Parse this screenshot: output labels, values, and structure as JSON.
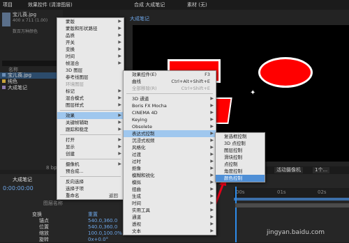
{
  "top_panel": {
    "label": "项目",
    "effects_tab": "效果控件 (清漆图层)",
    "comp_tab": "合成 大成笔记",
    "footage_tab": "素材 (无)"
  },
  "project_item": {
    "name": "宝儿莨.jpg",
    "size": "400 x 711 (1.00)",
    "mode": "数百万种颜色"
  },
  "project_list": [
    {
      "name": "宝儿莨.jpg",
      "color": "#6b8fb8"
    },
    {
      "name": "纯色",
      "color": "#c9a43a"
    },
    {
      "name": "大成笔记",
      "color": "#8c7bb0"
    }
  ],
  "project_header": {
    "name_col": "名称"
  },
  "comp_tab_label": "大成笔记",
  "bpc": "8 bpc",
  "camera": "活动摄像机",
  "views": "1个...",
  "timeline": {
    "tab": "大成笔记",
    "timecode": "0:00:00:00",
    "source_name_header": "图层名称",
    "ruler": [
      "00s",
      "01s",
      "02s"
    ],
    "rows": [
      {
        "label": "变换",
        "value": "重置"
      },
      {
        "label": "锚点",
        "value": "540.0,360.0"
      },
      {
        "label": "位置",
        "value": "540.0,360.0"
      },
      {
        "label": "缩放",
        "value": "100.0,100.0%"
      },
      {
        "label": "旋转",
        "value": "0x+0.0°"
      }
    ]
  },
  "menu_main": {
    "items": [
      {
        "label": "蒙版",
        "arrow": true
      },
      {
        "label": "蒙版和形状路径",
        "arrow": true
      },
      {
        "label": "品质",
        "arrow": true
      },
      {
        "label": "开关",
        "arrow": true
      },
      {
        "label": "变换",
        "arrow": true
      },
      {
        "label": "时间",
        "arrow": true
      },
      {
        "label": "帧混合",
        "arrow": true
      },
      {
        "label": "3D 图层"
      },
      {
        "label": "参考线图层"
      },
      {
        "label": "环境图层",
        "disabled": true
      },
      {
        "label": "标记",
        "arrow": true
      },
      {
        "label": "混合模式",
        "arrow": true
      },
      {
        "label": "图层样式",
        "arrow": true
      },
      {
        "sep": true
      },
      {
        "label": "效果",
        "arrow": true,
        "highlight": true
      },
      {
        "label": "关键帧辅助",
        "arrow": true
      },
      {
        "label": "跟踪和稳定",
        "arrow": true
      },
      {
        "sep": true
      },
      {
        "label": "打开",
        "arrow": true
      },
      {
        "label": "显示",
        "arrow": true
      },
      {
        "label": "创建",
        "arrow": true
      },
      {
        "sep": true
      },
      {
        "label": "摄像机",
        "arrow": true
      },
      {
        "label": "预合成..."
      },
      {
        "sep": true
      },
      {
        "label": "反向选择"
      },
      {
        "label": "选择子项"
      },
      {
        "label": "重命名",
        "shortcut": "返回"
      }
    ]
  },
  "menu_effects": {
    "items": [
      {
        "label": "效果控件(E)",
        "shortcut": "F3"
      },
      {
        "label": "曲线",
        "shortcut": "Ctrl+Alt+Shift+E"
      },
      {
        "label": "全部移除(R)",
        "shortcut": "Ctrl+Shift+E",
        "disabled": true
      },
      {
        "sep": true
      },
      {
        "label": "3D 通道",
        "arrow": true
      },
      {
        "label": "Boris FX Mocha",
        "arrow": true
      },
      {
        "label": "CINEMA 4D",
        "arrow": true
      },
      {
        "label": "Keying",
        "arrow": true
      },
      {
        "label": "Obsolete",
        "arrow": true
      },
      {
        "label": "表达式控制",
        "arrow": true,
        "highlight": true
      },
      {
        "label": "沉浸式视频",
        "arrow": true
      },
      {
        "label": "风格化",
        "arrow": true
      },
      {
        "label": "过渡",
        "arrow": true
      },
      {
        "label": "过时",
        "arrow": true
      },
      {
        "label": "抠像",
        "arrow": true
      },
      {
        "label": "模糊和锐化",
        "arrow": true
      },
      {
        "label": "模拟",
        "arrow": true
      },
      {
        "label": "扭曲",
        "arrow": true
      },
      {
        "label": "生成",
        "arrow": true
      },
      {
        "label": "时间",
        "arrow": true
      },
      {
        "label": "实用工具",
        "arrow": true
      },
      {
        "label": "通道",
        "arrow": true
      },
      {
        "label": "透视",
        "arrow": true
      },
      {
        "label": "文本",
        "arrow": true
      }
    ]
  },
  "menu_expr": {
    "items": [
      {
        "label": "复选框控制"
      },
      {
        "label": "3D 点控制"
      },
      {
        "label": "图层控制"
      },
      {
        "label": "滑块控制"
      },
      {
        "label": "点控制"
      },
      {
        "label": "角度控制"
      },
      {
        "label": "颜色控制",
        "highlight": true
      }
    ]
  },
  "colors": {
    "red": "#ff0000",
    "menu_bg": "#e8e8e8",
    "highlight": "#9fc7ee",
    "highlight_strong": "#4f8fd6",
    "accent_blue": "#2d8ceb"
  },
  "watermark": "jingyan.baidu.com"
}
